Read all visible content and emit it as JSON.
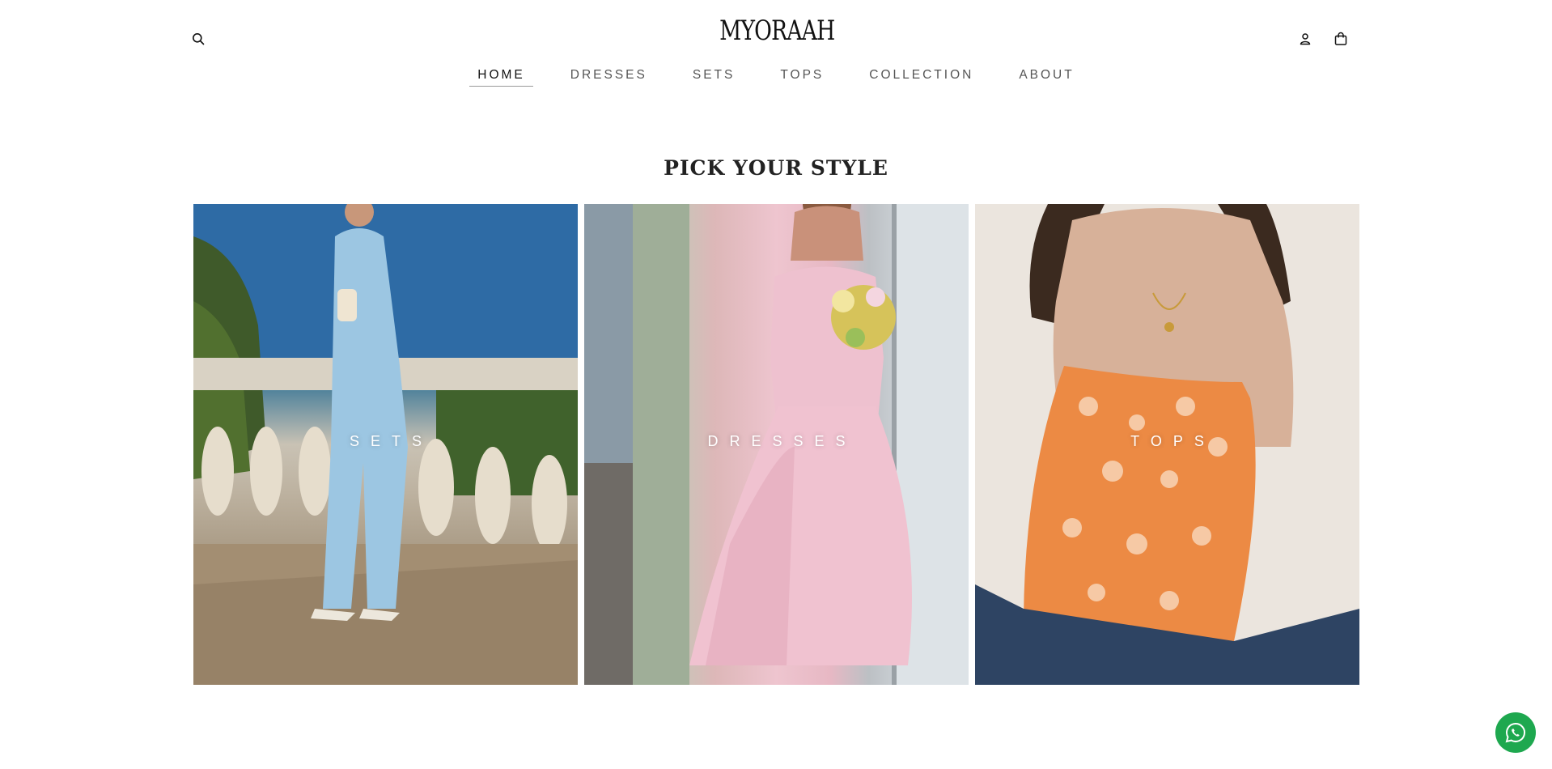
{
  "brand": {
    "logo_text": "MYORAAH"
  },
  "header": {
    "search_icon": "search-icon",
    "account_icon": "user-icon",
    "cart_icon": "shopping-bag-icon"
  },
  "nav": {
    "items": [
      {
        "label": "HOME",
        "active": true
      },
      {
        "label": "DRESSES",
        "active": false
      },
      {
        "label": "SETS",
        "active": false
      },
      {
        "label": "TOPS",
        "active": false
      },
      {
        "label": "COLLECTION",
        "active": false
      },
      {
        "label": "ABOUT",
        "active": false
      }
    ]
  },
  "section": {
    "title": "PICK YOUR STYLE"
  },
  "tiles": [
    {
      "label": "SETS",
      "image": "model-in-light-blue-jumpsuit-by-sea-balustrade"
    },
    {
      "label": "DRESSES",
      "image": "model-in-pink-strapless-dress-holding-flowers"
    },
    {
      "label": "TOPS",
      "image": "model-in-orange-floral-strapless-top"
    }
  ],
  "floating": {
    "whatsapp_icon": "whatsapp-icon"
  },
  "colors": {
    "text": "#1a1a1a",
    "nav_inactive": "#555555",
    "whatsapp": "#1ea84f"
  }
}
